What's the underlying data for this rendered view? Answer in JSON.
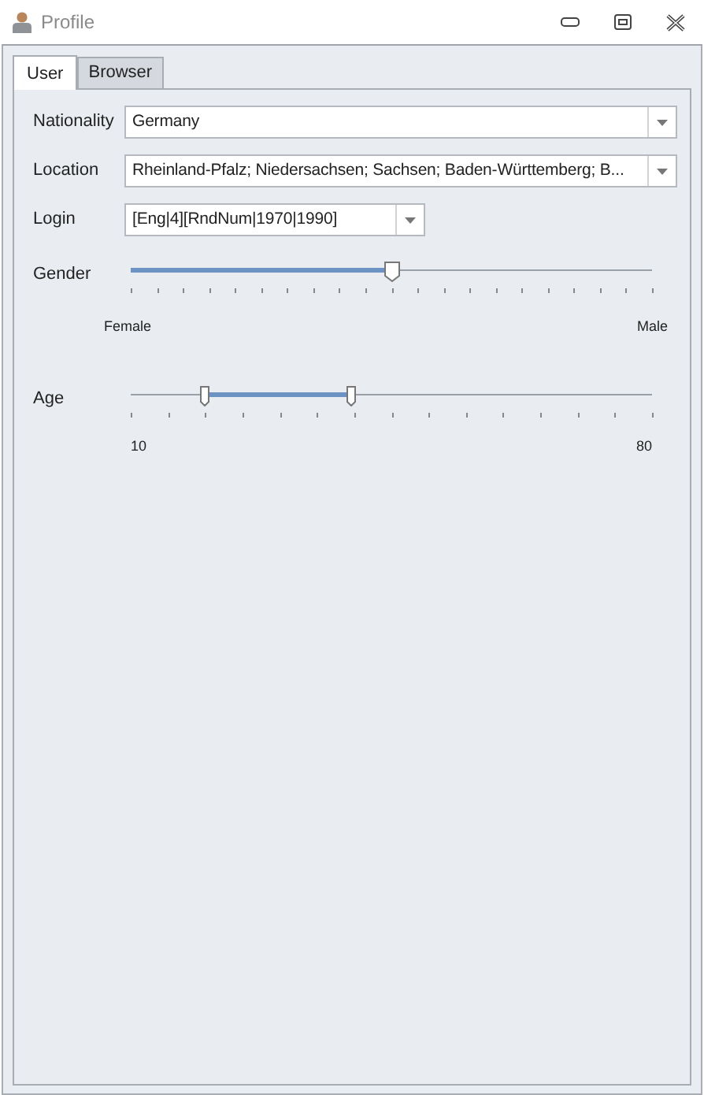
{
  "window": {
    "title": "Profile"
  },
  "tabs": [
    {
      "label": "User",
      "selected": true
    },
    {
      "label": "Browser",
      "selected": false
    }
  ],
  "fields": [
    {
      "label": "Nationality",
      "value": "Germany",
      "wide": true
    },
    {
      "label": "Location",
      "value": "Rheinland-Pfalz; Niedersachsen; Sachsen; Baden-Württemberg; B...",
      "wide": true
    },
    {
      "label": "Login",
      "value": "[Eng|4][RndNum|1970|1990]",
      "wide": false
    }
  ],
  "sliders": [
    {
      "label": "Gender",
      "kind": "single",
      "thumbs": [
        {
          "level": 0.5
        }
      ],
      "min_label": "Female",
      "max_label": "Male"
    },
    {
      "label": "Age",
      "kind": "range",
      "thumbs": [
        {
          "level": 0.136
        },
        {
          "level": 0.417
        }
      ],
      "min_label": "10",
      "max_label": "80"
    }
  ]
}
